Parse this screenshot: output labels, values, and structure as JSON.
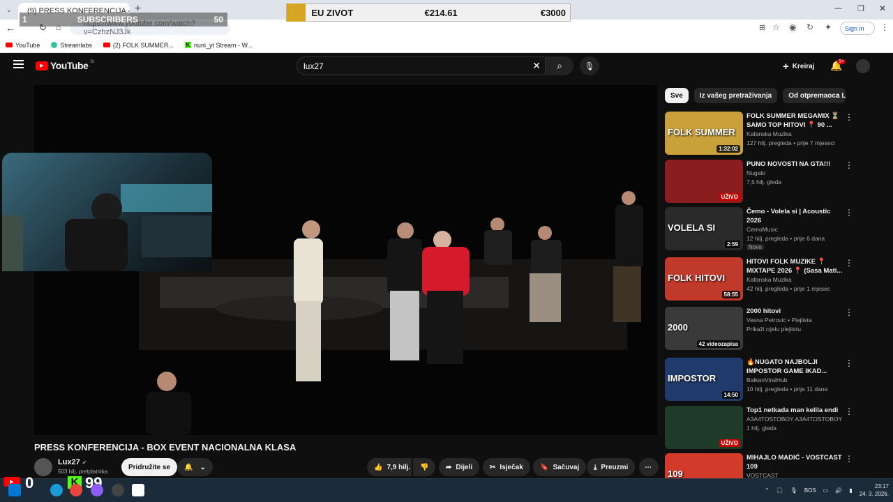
{
  "browser": {
    "tab_title": "(9) PRESS KONFERENCIJA - BOX E",
    "url": "https://www.youtube.com/watch?v=CzhzNJ3Jk",
    "sign_in": "Sign in",
    "bookmarks": [
      "YouTube",
      "Streamlabs",
      "(2) FOLK SUMMER...",
      "nuni_yt Stream - W..."
    ]
  },
  "overlay": {
    "subscribers_label": "SUBSCRIBERS",
    "subscribers_count": "50",
    "subscribers_prefix": "1",
    "eu_label": "EU ZIVOT",
    "eu_value1": "€214.61",
    "eu_value2": "€3000"
  },
  "youtube": {
    "logo_text": "YouTube",
    "logo_country": "SI",
    "search_value": "lux27",
    "create_label": "Kreiraj",
    "notif_count": "9+"
  },
  "chips": [
    "Sve",
    "Iz vašeg pretraživanja",
    "Od otpremaoca Lu"
  ],
  "video": {
    "title": "PRESS KONFERENCIJA - BOX EVENT NACIONALNA KLASA",
    "channel": "Lux27",
    "subs": "503 hilj. pretplatnika",
    "join": "Pridružite se",
    "likes": "7,9 hilj.",
    "share": "Dijeli",
    "clip": "Isječak",
    "save": "Sačuvaj",
    "download": "Preuzmi"
  },
  "recommendations": [
    {
      "title": "FOLK SUMMER MEGAMIX ⏳ SAMO TOP HITOVI 📍 90 ...",
      "channel": "Kafanska Muzika",
      "meta": "127 hilj. pregleda • prije 7 mjeseci",
      "duration": "1:32:02",
      "thumb_text": "FOLK SUMMER",
      "thumb_color": "#c9a03a"
    },
    {
      "title": "PUNO NOVOSTI NA GTA!!!",
      "channel": "Nugato",
      "meta": "7,5 hilj. gleda",
      "duration": "UŽIVO",
      "thumb_text": "",
      "thumb_color": "#8a1e1e"
    },
    {
      "title": "Čemo - Volela si | Acoustic 2026",
      "channel": "CemoMusic",
      "meta": "12 hilj. pregleda • prije 6 dana",
      "duration": "2:59",
      "badge": "Novo",
      "thumb_text": "VOLELA SI",
      "thumb_color": "#2a2a2a"
    },
    {
      "title": "HITOVI FOLK MUZIKE 📍 MIXTAPE 2026 📍 (Sasa Mati...",
      "channel": "Kafanska Muzika",
      "meta": "42 hilj. pregleda • prije 1 mjesec",
      "duration": "58:55",
      "thumb_text": "FOLK HITOVI",
      "thumb_color": "#c0392b"
    },
    {
      "title": "2000 hitovi",
      "channel": "Vesna Petrovic • Plejlista",
      "meta": "Prikaži cijelu plejlistu",
      "duration": "42 videozapisa",
      "thumb_text": "2000",
      "thumb_color": "#3a3a3a"
    },
    {
      "title": "🔥NUGATO NAJBOLJI IMPOSTOR GAME IKAD...",
      "channel": "BalkanViralHub",
      "meta": "10 hilj. pregleda • prije 11 dana",
      "duration": "14:50",
      "thumb_text": "IMPOSTOR",
      "thumb_color": "#1f3a6b"
    },
    {
      "title": "Top1 netkada man kelila endi",
      "channel": "A3A4TOSTOBOY A3A4TOSTOBOY",
      "meta": "1 hilj. gleda",
      "duration": "UŽIVO",
      "thumb_text": "",
      "thumb_color": "#1f3b2a"
    },
    {
      "title": "MIHAJLO MADIĆ - VOSTCAST 109",
      "channel": "VOSTCAST",
      "meta": "",
      "duration": "",
      "thumb_text": "109",
      "thumb_color": "#d23a2a"
    }
  ],
  "taskbar": {
    "youtube_count": "0",
    "kick_count": "99",
    "language": "BOS",
    "time": "23:17",
    "date": "24. 3. 2026."
  }
}
